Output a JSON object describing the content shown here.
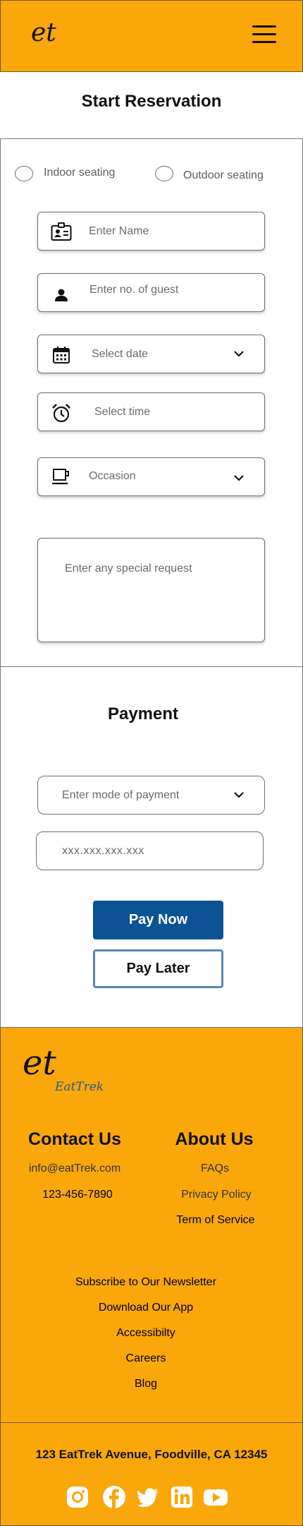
{
  "header": {
    "logo": "et",
    "menu_icon": "hamburger-menu-icon"
  },
  "page_title": "Start Reservation",
  "seating": {
    "indoor_label": "Indoor seating",
    "outdoor_label": "Outdoor seating"
  },
  "form": {
    "name_placeholder": "Enter Name",
    "guests_placeholder": "Enter no. of guest",
    "date_placeholder": "Select date",
    "time_placeholder": "Select time",
    "occasion_placeholder": "Occasion",
    "special_request_placeholder": "Enter any special request"
  },
  "icons": {
    "name": "id-card-icon",
    "guests": "person-icon",
    "date": "calendar-icon",
    "time": "alarm-clock-icon",
    "occasion": "coffee-cup-icon",
    "dropdown": "chevron-down-icon"
  },
  "payment": {
    "title": "Payment",
    "mode_placeholder": "Enter mode of payment",
    "card_placeholder": "xxx.xxx.xxx.xxx",
    "pay_now_label": "Pay Now",
    "pay_later_label": "Pay Later"
  },
  "footer": {
    "logo": "et",
    "brand": "EatTrek",
    "contact": {
      "heading": "Contact Us",
      "email": "info@eatTrek.com",
      "phone": "123-456-7890"
    },
    "about": {
      "heading": "About Us",
      "links": [
        "FAQs",
        "Privacy Policy",
        "Term of Service"
      ]
    },
    "links": [
      "Subscribe to Our Newsletter",
      "Download Our App",
      "Accessibilty",
      "Careers",
      "Blog"
    ],
    "address": "123 EatTrek Avenue, Foodville, CA 12345",
    "social": [
      "instagram-icon",
      "facebook-icon",
      "twitter-icon",
      "linkedin-icon",
      "youtube-icon"
    ]
  },
  "colors": {
    "brand_orange": "#F9A70A",
    "primary_blue": "#0b5394",
    "outline_blue": "#5a86b8",
    "logo_blue": "#1d5f8e"
  }
}
